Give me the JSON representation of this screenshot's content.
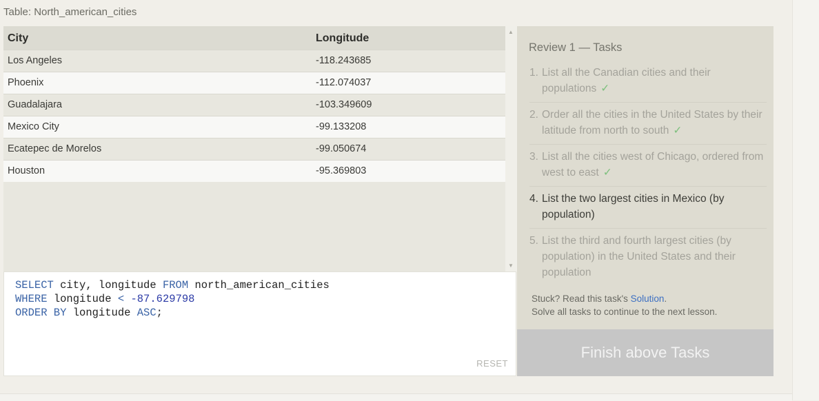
{
  "table_caption": "Table: North_american_cities",
  "results": {
    "columns": [
      "City",
      "Longitude"
    ],
    "rows": [
      [
        "Los Angeles",
        "-118.243685"
      ],
      [
        "Phoenix",
        "-112.074037"
      ],
      [
        "Guadalajara",
        "-103.349609"
      ],
      [
        "Mexico City",
        "-99.133208"
      ],
      [
        "Ecatepec de Morelos",
        "-99.050674"
      ],
      [
        "Houston",
        "-95.369803"
      ]
    ]
  },
  "editor": {
    "line1": {
      "kw1": "SELECT",
      "t1": " city, longitude ",
      "kw2": "FROM",
      "t2": " north_american_cities"
    },
    "line2": {
      "kw1": "WHERE",
      "t1": " longitude ",
      "op": "<",
      "num": " -87.629798"
    },
    "line3": {
      "kw1": "ORDER BY",
      "t1": " longitude ",
      "kw2": "ASC",
      "t2": ";"
    },
    "reset_label": "RESET"
  },
  "tasks": {
    "title": "Review 1 — Tasks",
    "items": [
      {
        "num": "1.",
        "text": "List all the Canadian cities and their populations",
        "check": "✓"
      },
      {
        "num": "2.",
        "text": "Order all the cities in the United States by their latitude from north to south",
        "check": "✓"
      },
      {
        "num": "3.",
        "text": "List all the cities west of Chicago, ordered from west to east",
        "check": "✓"
      },
      {
        "num": "4.",
        "text": "List the two largest cities in Mexico (by population)",
        "check": ""
      },
      {
        "num": "5.",
        "text": "List the third and fourth largest cities (by population) in the United States and their population",
        "check": ""
      }
    ],
    "stuck_prefix": "Stuck? Read this task's ",
    "solution_link": "Solution",
    "stuck_suffix": ".",
    "solve_all": "Solve all tasks to continue to the next lesson."
  },
  "finish_button": "Finish above Tasks",
  "colors": {
    "keyword": "#3a63a6",
    "check": "#7ec07e",
    "link": "#3c6fc2"
  }
}
